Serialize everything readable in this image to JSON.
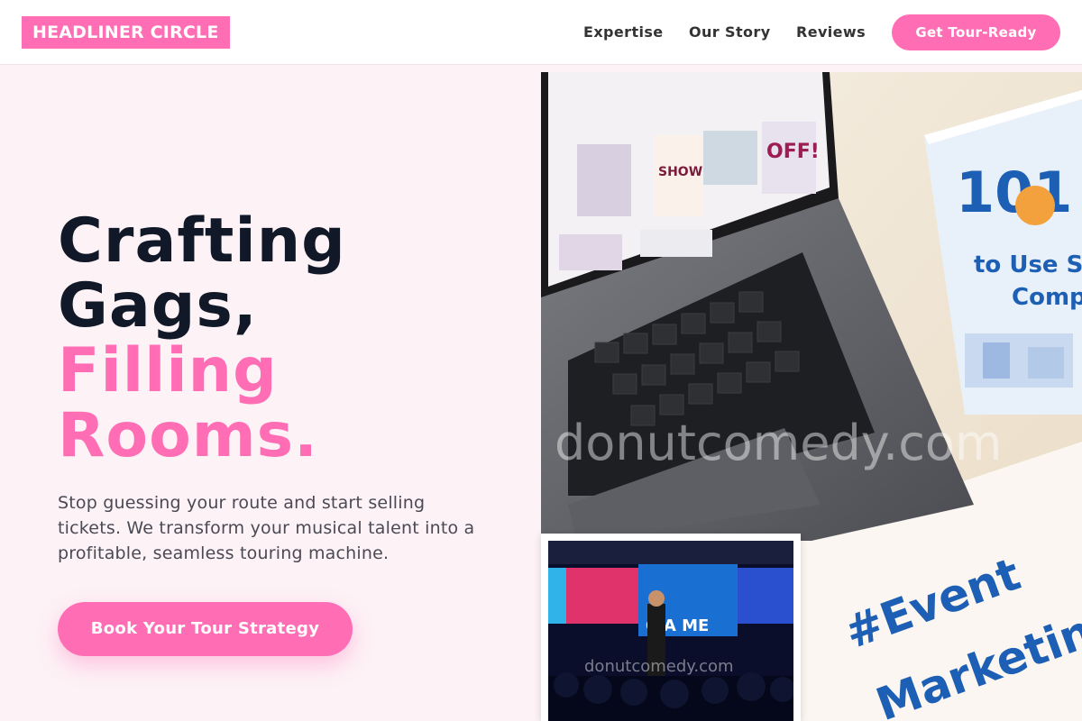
{
  "header": {
    "logo": "HEADLINER CIRCLE",
    "nav": [
      {
        "label": "Expertise"
      },
      {
        "label": "Our Story"
      },
      {
        "label": "Reviews"
      }
    ],
    "cta": "Get Tour-Ready"
  },
  "hero": {
    "title_line1": "Crafting",
    "title_line2": "Gags,",
    "title_line3": "Filling",
    "title_line4": "Rooms.",
    "subtitle": "Stop guessing your route and start selling tickets. We transform your musical talent into a profitable, seamless touring machine.",
    "cta": "Book Your Tour Strategy"
  },
  "image": {
    "watermark": "donutcomedy.com",
    "card_number": "101",
    "card_line1": "to Use S",
    "card_line2": "Comp",
    "paper_line1": "#Event",
    "paper_line2": "Marketin",
    "screen_logo": "OFF!",
    "screen_label": "SHOW ROOM",
    "inset_watermark": "donutcomedy.com",
    "inset_screen_text": "CIA ME"
  },
  "colors": {
    "accent": "#ff6eb4",
    "heading": "#111827",
    "background": "#fdf2f6"
  }
}
